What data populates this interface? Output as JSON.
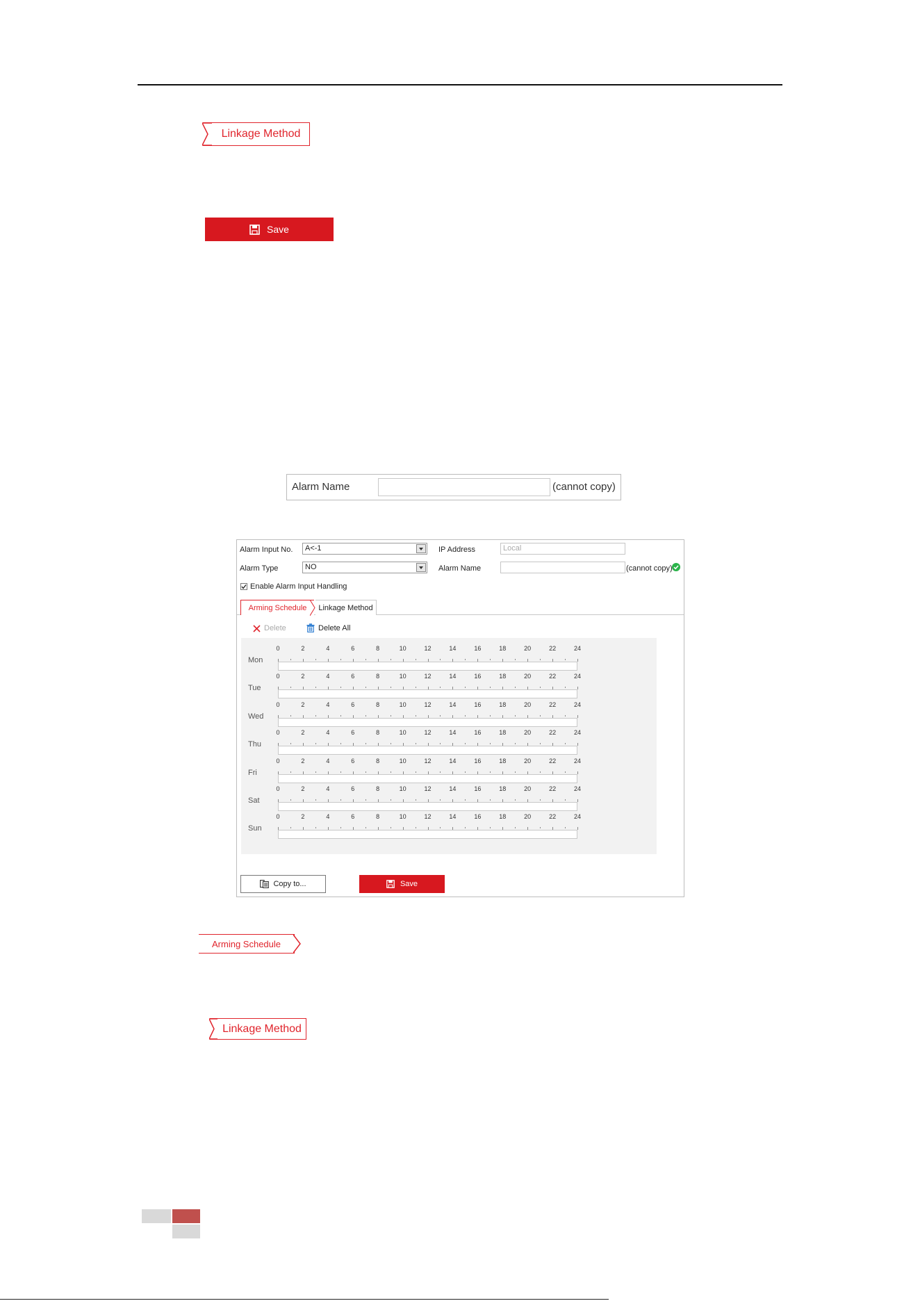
{
  "doc": {
    "ref_tab_1": "Linkage Method",
    "save_label": "Save",
    "ref_tab_2": "Arming Schedule",
    "ref_tab_3": "Linkage Method"
  },
  "alarm_name_box": {
    "label": "Alarm Name",
    "note": "(cannot copy)"
  },
  "panel": {
    "alarm_input_no_label": "Alarm Input No.",
    "alarm_input_no_value": "A<-1",
    "ip_address_label": "IP Address",
    "ip_address_placeholder": "Local",
    "alarm_type_label": "Alarm Type",
    "alarm_type_value": "NO",
    "alarm_name_label": "Alarm Name",
    "alarm_name_note": "(cannot copy)",
    "enable_label": "Enable Alarm Input Handling",
    "enable_checked": true,
    "tabs": [
      "Arming Schedule",
      "Linkage Method"
    ],
    "delete_label": "Delete",
    "delete_all_label": "Delete All",
    "days": [
      "Mon",
      "Tue",
      "Wed",
      "Thu",
      "Fri",
      "Sat",
      "Sun"
    ],
    "hours": [
      "0",
      "2",
      "4",
      "6",
      "8",
      "10",
      "12",
      "14",
      "16",
      "18",
      "20",
      "22",
      "24"
    ],
    "copy_label": "Copy to...",
    "save_label": "Save"
  },
  "colors": {
    "accent": "#d7181f",
    "check_ok": "#2bb34a"
  }
}
